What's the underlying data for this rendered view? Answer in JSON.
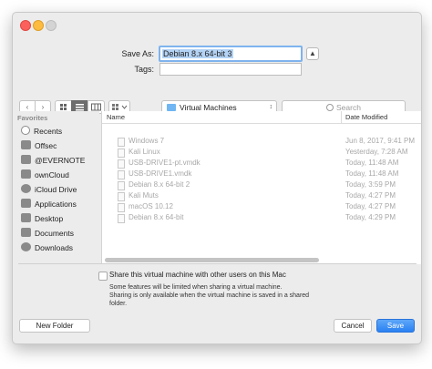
{
  "dialog": {
    "save_as_label": "Save As:",
    "save_as_value": "Debian 8.x 64-bit 3",
    "tags_label": "Tags:",
    "tags_value": "",
    "location": "Virtual Machines",
    "search_placeholder": "Search"
  },
  "sidebar": {
    "header": "Favorites",
    "items": [
      {
        "label": "Recents",
        "icon": "clock-icon"
      },
      {
        "label": "Offsec",
        "icon": "folder-icon"
      },
      {
        "label": "@EVERNOTE",
        "icon": "folder-icon"
      },
      {
        "label": "ownCloud",
        "icon": "folder-icon"
      },
      {
        "label": "iCloud Drive",
        "icon": "cloud-icon"
      },
      {
        "label": "Applications",
        "icon": "applications-icon"
      },
      {
        "label": "Desktop",
        "icon": "desktop-icon"
      },
      {
        "label": "Documents",
        "icon": "documents-icon"
      },
      {
        "label": "Downloads",
        "icon": "downloads-icon"
      }
    ]
  },
  "files": {
    "columns": [
      "Name",
      "Date Modified"
    ],
    "rows": [
      {
        "name": "Windows 7",
        "date": "Jun 8, 2017, 9:41 PM"
      },
      {
        "name": "Kali Linux",
        "date": "Yesterday, 7:28 AM"
      },
      {
        "name": "USB-DRIVE1-pt.vmdk",
        "date": "Today, 11:48 AM"
      },
      {
        "name": "USB-DRIVE1.vmdk",
        "date": "Today, 11:48 AM"
      },
      {
        "name": "Debian 8.x 64-bit 2",
        "date": "Today, 3:59 PM"
      },
      {
        "name": "Kali Muts",
        "date": "Today, 4:27 PM"
      },
      {
        "name": "macOS 10.12",
        "date": "Today, 4:27 PM"
      },
      {
        "name": "Debian 8.x 64-bit",
        "date": "Today, 4:29 PM"
      }
    ]
  },
  "accessory": {
    "share_label": "Share this virtual machine with other users on this Mac",
    "share_checked": false,
    "note_line1": "Some features will be limited when sharing a virtual machine.",
    "note_line2": "Sharing is only available when the virtual machine is saved in a shared",
    "note_line3": "folder."
  },
  "buttons": {
    "new_folder": "New Folder",
    "cancel": "Cancel",
    "save": "Save"
  },
  "colors": {
    "accent": "#2a80f2",
    "selection": "#b3d3f5"
  }
}
